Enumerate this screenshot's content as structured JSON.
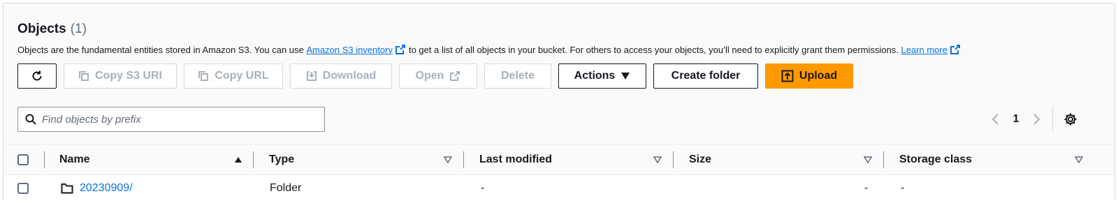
{
  "header": {
    "title": "Objects",
    "count": "(1)"
  },
  "description": {
    "text_before": "Objects are the fundamental entities stored in Amazon S3. You can use",
    "inventory_link": "Amazon S3 inventory",
    "text_middle": "to get a list of all objects in your bucket. For others to access your objects, you’ll need to explicitly grant them permissions.",
    "learn_more": "Learn more"
  },
  "toolbar": {
    "copy_s3_uri": "Copy S3 URI",
    "copy_url": "Copy URL",
    "download": "Download",
    "open": "Open",
    "delete": "Delete",
    "actions": "Actions",
    "create_folder": "Create folder",
    "upload": "Upload"
  },
  "search": {
    "placeholder": "Find objects by prefix",
    "value": ""
  },
  "pagination": {
    "current_page": "1"
  },
  "table": {
    "columns": [
      "Name",
      "Type",
      "Last modified",
      "Size",
      "Storage class"
    ],
    "rows": [
      {
        "name": "20230909/",
        "type": "Folder",
        "last_modified": "-",
        "size": "-",
        "storage_class": "-"
      }
    ]
  },
  "colors": {
    "link": "#0972d3",
    "primary": "#ff9900",
    "disabled": "#a9b1ba"
  }
}
